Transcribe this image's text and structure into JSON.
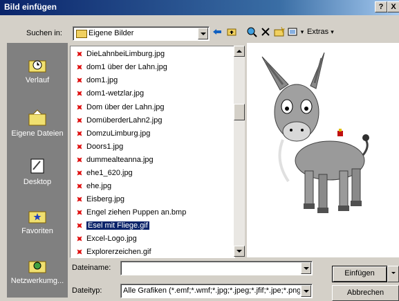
{
  "window": {
    "title": "Bild einfügen",
    "help": "?",
    "close": "X"
  },
  "lookin": {
    "label": "Suchen in:",
    "value": "Eigene Bilder"
  },
  "toolbar": {
    "extras_label": "Extras"
  },
  "places": [
    {
      "label": "Verlauf",
      "icon": "history-icon"
    },
    {
      "label": "Eigene Dateien",
      "icon": "my-documents-icon"
    },
    {
      "label": "Desktop",
      "icon": "desktop-icon"
    },
    {
      "label": "Favoriten",
      "icon": "favorites-icon"
    },
    {
      "label": "Netzwerkumg...",
      "icon": "network-icon"
    }
  ],
  "files": [
    "DieLahnbeiLimburg.jpg",
    "dom1 über der Lahn.jpg",
    "dom1.jpg",
    "dom1-wetzlar.jpg",
    "Dom über der Lahn.jpg",
    "DomüberderLahn2.jpg",
    "DomzuLimburg.jpg",
    "Doors1.jpg",
    "dummealteanna.jpg",
    "ehe1_620.jpg",
    "ehe.jpg",
    "Eisberg.jpg",
    "Engel ziehen Puppen an.bmp",
    "Esel mit Fliege.gif",
    "Excel-Logo.jpg",
    "Explorerzeichen.gif"
  ],
  "selected_file": "Esel mit Fliege.gif",
  "filename": {
    "label": "Dateiname:",
    "value": ""
  },
  "filetype": {
    "label": "Dateityp:",
    "value": "Alle Grafiken (*.emf;*.wmf;*.jpg;*.jpeg;*.jfif;*.jpe;*.png"
  },
  "buttons": {
    "insert": "Einfügen",
    "cancel": "Abbrechen"
  }
}
